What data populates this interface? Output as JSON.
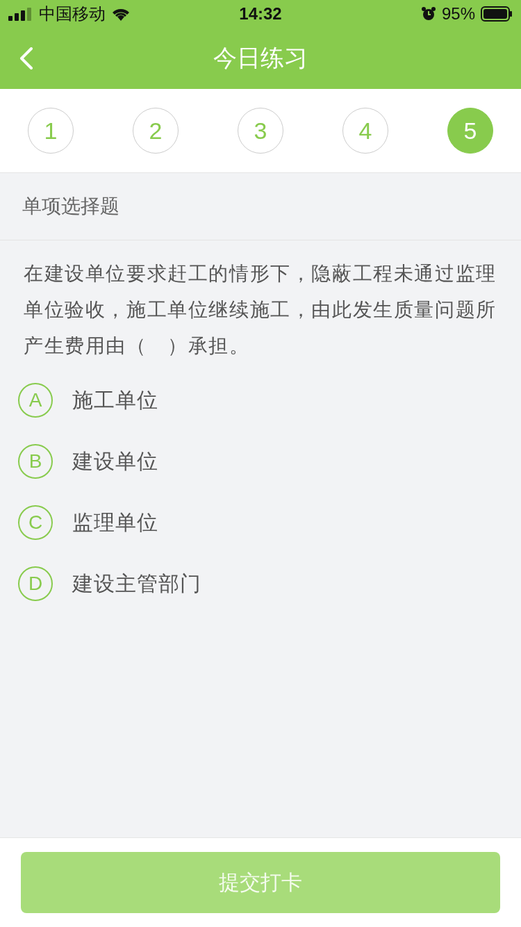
{
  "status_bar": {
    "carrier": "中国移动",
    "time": "14:32",
    "battery": "95%"
  },
  "nav": {
    "title": "今日练习"
  },
  "steps": [
    {
      "label": "1",
      "selected": false
    },
    {
      "label": "2",
      "selected": false
    },
    {
      "label": "3",
      "selected": false
    },
    {
      "label": "4",
      "selected": false
    },
    {
      "label": "5",
      "selected": true
    }
  ],
  "question": {
    "type": "单项选择题",
    "text": "在建设单位要求赶工的情形下，隐蔽工程未通过监理单位验收，施工单位继续施工，由此发生质量问题所产生费用由（　）承担。"
  },
  "options": [
    {
      "letter": "A",
      "text": "施工单位",
      "selected": false
    },
    {
      "letter": "B",
      "text": "建设单位",
      "selected": false
    },
    {
      "letter": "C",
      "text": "监理单位",
      "selected": false
    },
    {
      "letter": "D",
      "text": "建设主管部门",
      "selected": false
    }
  ],
  "submit": {
    "label": "提交打卡",
    "disabled": true
  }
}
